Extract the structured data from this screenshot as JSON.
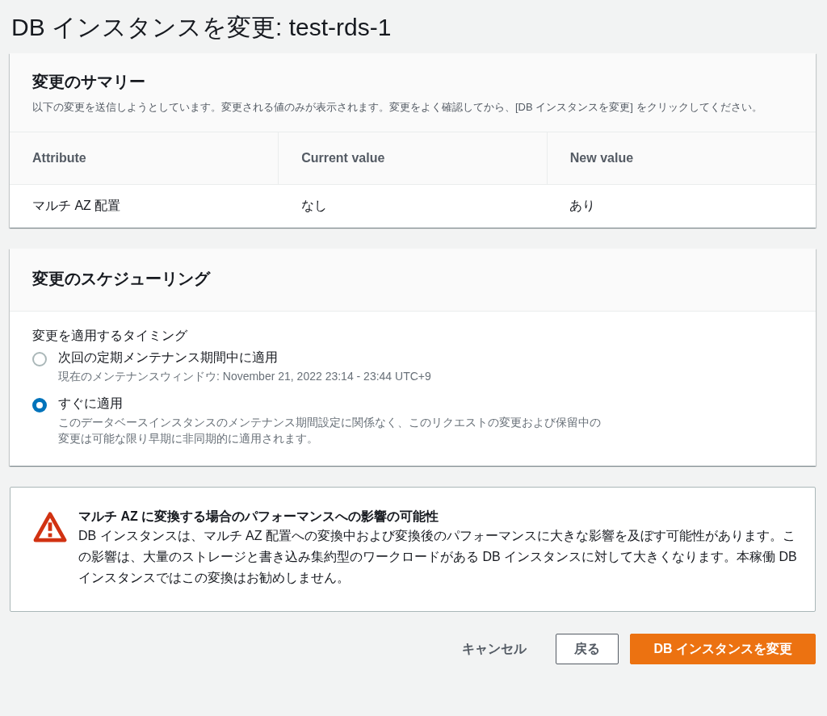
{
  "page_title": "DB インスタンスを変更: test-rds-1",
  "summary": {
    "title": "変更のサマリー",
    "description": "以下の変更を送信しようとしています。変更される値のみが表示されます。変更をよく確認してから、[DB インスタンスを変更] をクリックしてください。",
    "table": {
      "columns": [
        "Attribute",
        "Current value",
        "New value"
      ],
      "rows": [
        [
          "マルチ AZ 配置",
          "なし",
          "あり"
        ]
      ]
    }
  },
  "scheduling": {
    "title": "変更のスケジューリング",
    "label": "変更を適用するタイミング",
    "options": [
      {
        "label": "次回の定期メンテナンス期間中に適用",
        "description": "現在のメンテナンスウィンドウ: November 21, 2022 23:14 - 23:44 UTC+9",
        "selected": false
      },
      {
        "label": "すぐに適用",
        "description": "このデータベースインスタンスのメンテナンス期間設定に関係なく、このリクエストの変更および保留中の変更は可能な限り早期に非同期的に適用されます。",
        "selected": true
      }
    ]
  },
  "warning": {
    "title": "マルチ AZ に変換する場合のパフォーマンスへの影響の可能性",
    "message": "DB インスタンスは、マルチ AZ 配置への変換中および変換後のパフォーマンスに大きな影響を及ぼす可能性があります。この影響は、大量のストレージと書き込み集約型のワークロードがある DB インスタンスに対して大きくなります。本稼働 DB インスタンスではこの変換はお勧めしません。"
  },
  "buttons": [
    {
      "label": "キャンセル",
      "kind": "link"
    },
    {
      "label": "戻る",
      "kind": "normal"
    },
    {
      "label": "DB インスタンスを変更",
      "kind": "primary"
    }
  ]
}
